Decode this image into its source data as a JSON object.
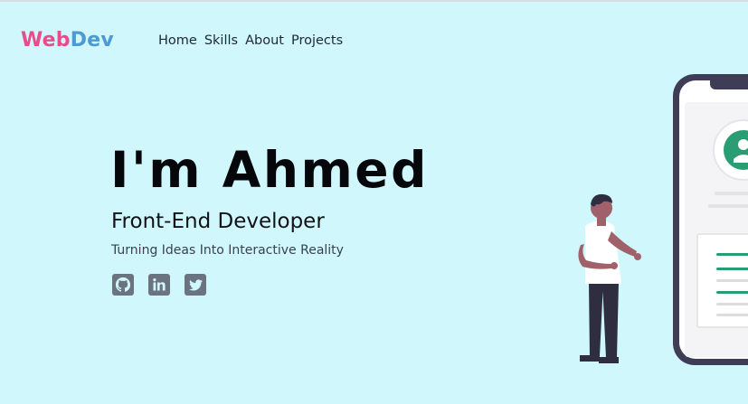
{
  "brand": {
    "part1": "Web",
    "part2": "Dev",
    "colors": {
      "part1": "#ec4b8b",
      "part2": "#4d9ad1"
    }
  },
  "nav": {
    "items": [
      {
        "label": "Home"
      },
      {
        "label": "Skills"
      },
      {
        "label": "About"
      },
      {
        "label": "Projects"
      }
    ]
  },
  "hero": {
    "name": "I'm Ahmed",
    "role": "Front-End Developer",
    "tagline": "Turning Ideas Into Interactive Reality"
  },
  "social": {
    "icons": [
      "github-icon",
      "linkedin-icon",
      "twitter-icon"
    ]
  },
  "theme": {
    "background": "#cff7fc",
    "accent": "#2a9d74",
    "icon_gray": "#6b7380"
  }
}
